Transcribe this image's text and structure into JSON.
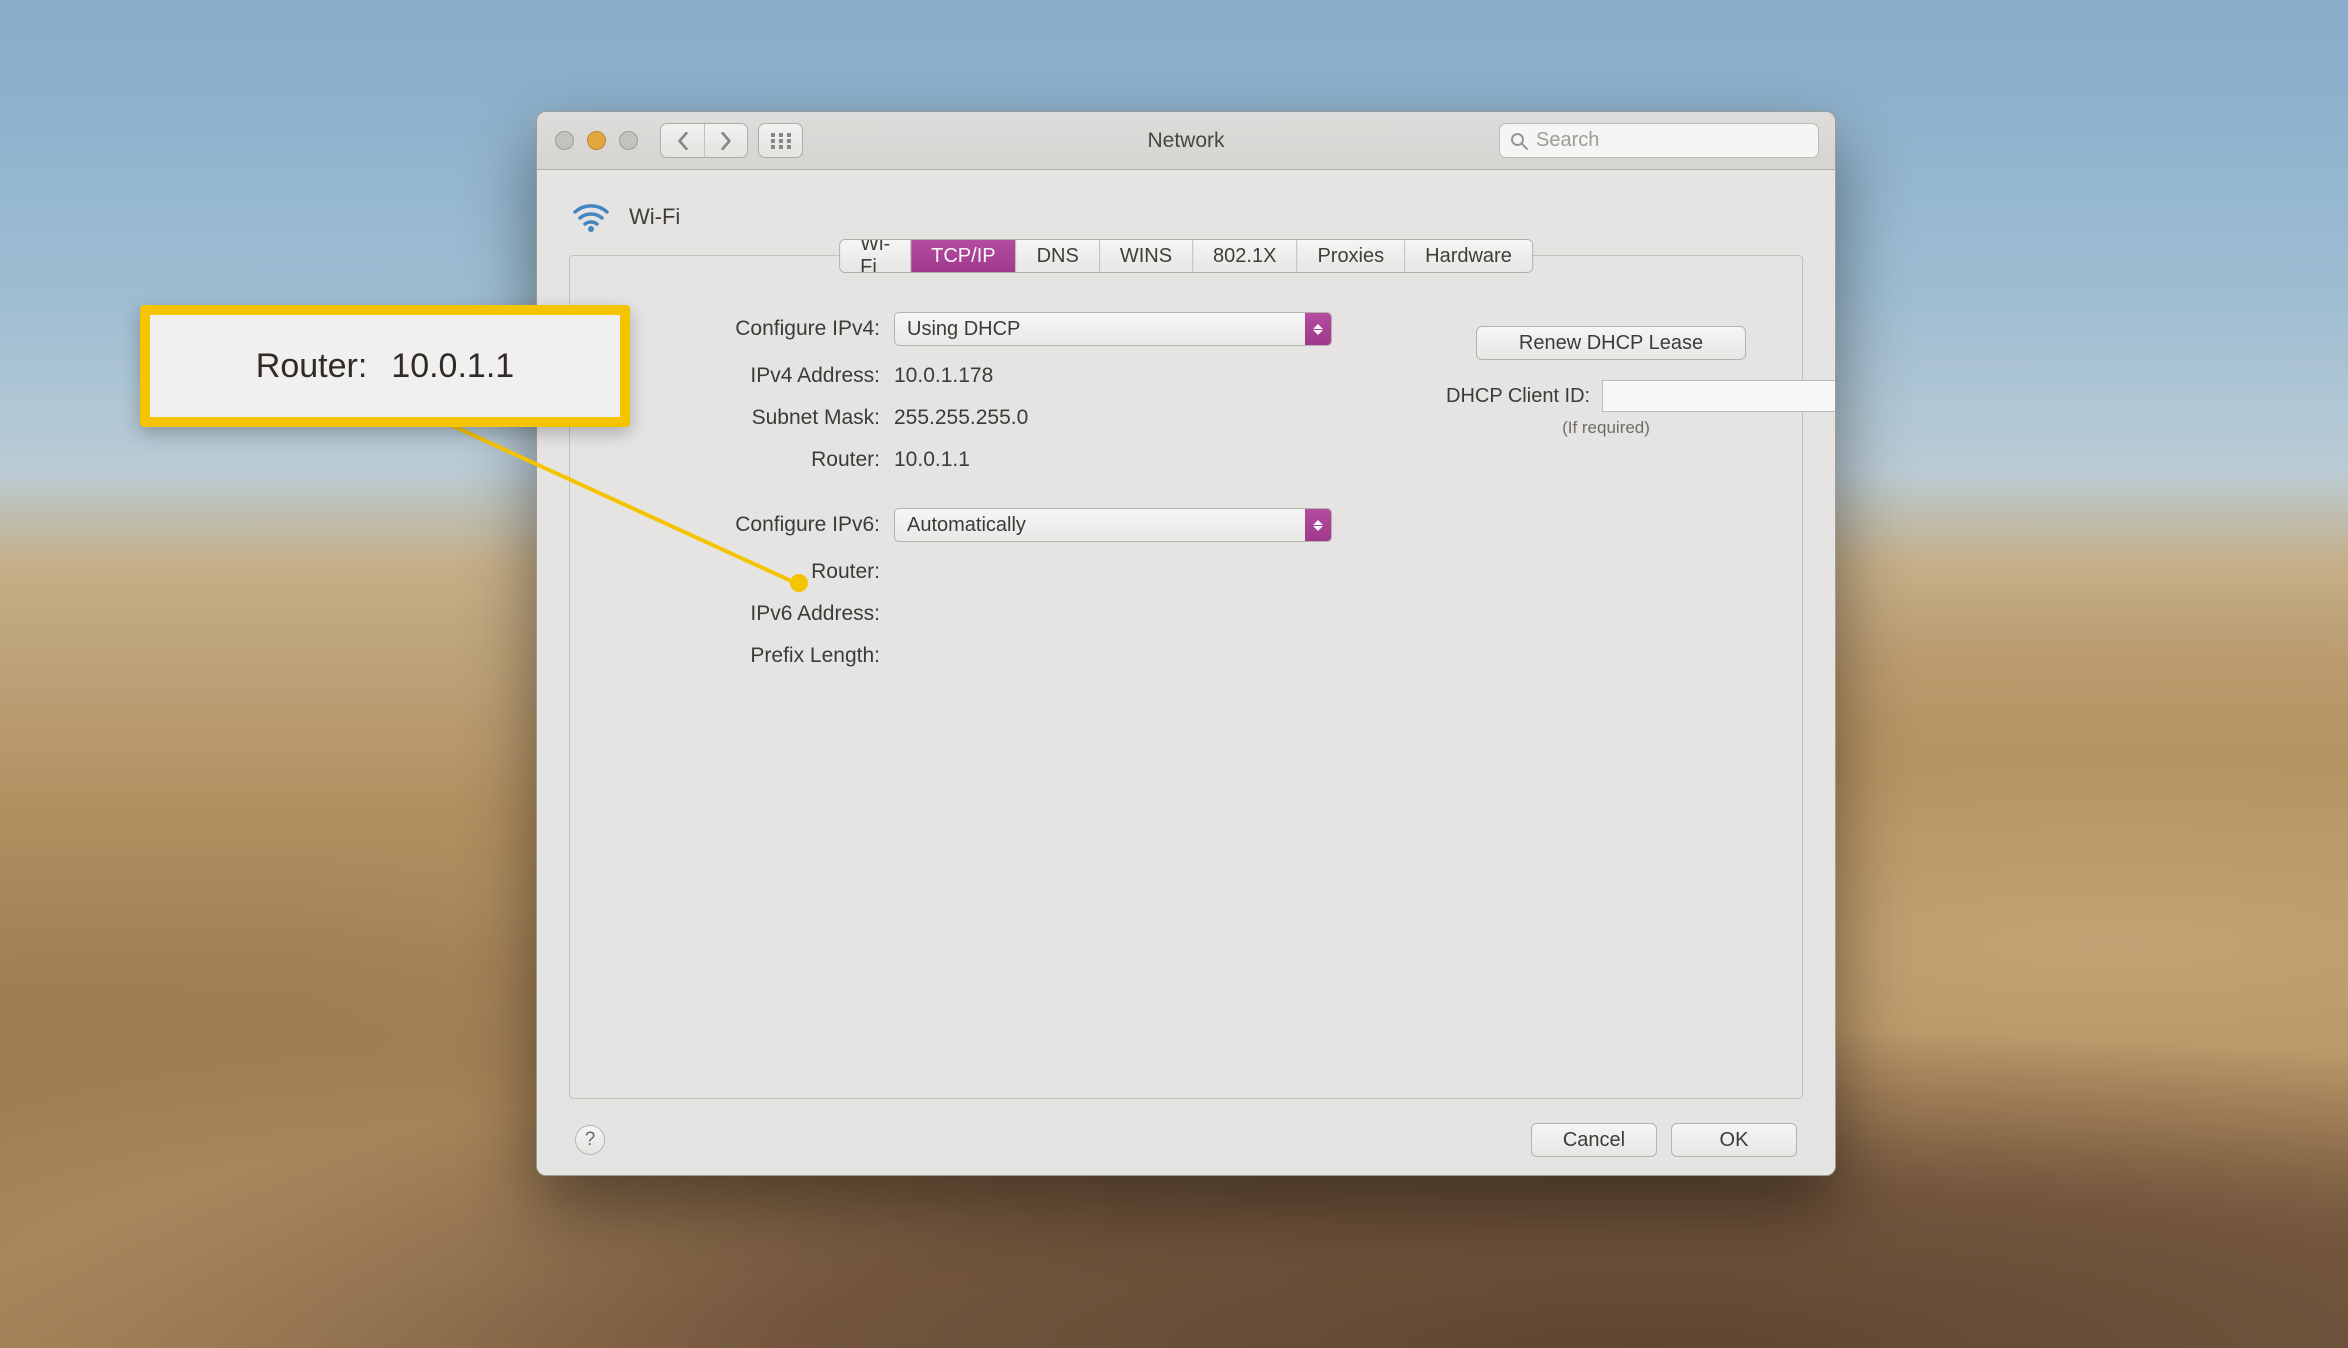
{
  "window": {
    "title": "Network",
    "search_placeholder": "Search"
  },
  "header": {
    "wifi_label": "Wi-Fi"
  },
  "tabs": [
    {
      "label": "Wi-Fi"
    },
    {
      "label": "TCP/IP",
      "active": true
    },
    {
      "label": "DNS"
    },
    {
      "label": "WINS"
    },
    {
      "label": "802.1X"
    },
    {
      "label": "Proxies"
    },
    {
      "label": "Hardware"
    }
  ],
  "ipv4": {
    "configure_label": "Configure IPv4:",
    "configure_value": "Using DHCP",
    "address_label": "IPv4 Address:",
    "address_value": "10.0.1.178",
    "subnet_label": "Subnet Mask:",
    "subnet_value": "255.255.255.0",
    "router_label": "Router:",
    "router_value": "10.0.1.1"
  },
  "dhcp": {
    "renew_label": "Renew DHCP Lease",
    "client_id_label": "DHCP Client ID:",
    "client_id_value": "",
    "if_required": "(If required)"
  },
  "ipv6": {
    "configure_label": "Configure IPv6:",
    "configure_value": "Automatically",
    "router_label": "Router:",
    "router_value": "",
    "address_label": "IPv6 Address:",
    "address_value": "",
    "prefix_label": "Prefix Length:",
    "prefix_value": ""
  },
  "footer": {
    "help": "?",
    "cancel": "Cancel",
    "ok": "OK"
  },
  "callout": {
    "label": "Router:",
    "value": "10.0.1.1"
  }
}
